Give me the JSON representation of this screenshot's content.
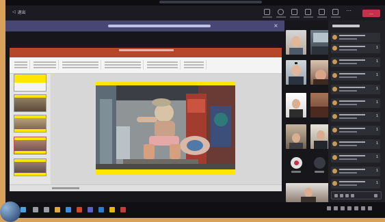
{
  "topbar": {
    "exit_label": "退出",
    "leave_label": "…"
  },
  "chat": {
    "badges": [
      "1",
      "1",
      "1",
      "1",
      "1",
      "1",
      "1",
      "1",
      "1",
      "1",
      "1"
    ]
  },
  "colors": {
    "notice_bar": "#464775",
    "ppt_accent": "#b7472a",
    "slide_background": "#ffe600",
    "leave_button": "#c4314b",
    "mute_button": "#e2e2e2",
    "camera_button": "#3a3a42"
  },
  "icons": [
    "camera-icon",
    "microphone-icon",
    "share-icon",
    "raise-hand-icon",
    "people-icon",
    "chat-icon",
    "more-icon",
    "leave-icon",
    "close-icon",
    "windows-start-icon"
  ]
}
